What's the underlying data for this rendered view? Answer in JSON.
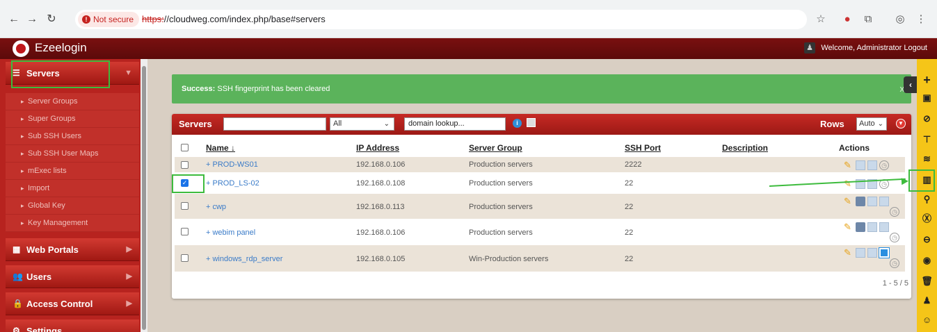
{
  "browser": {
    "not_secure": "Not secure",
    "url_scheme": "https:",
    "url_rest": "//cloudweg.com/index.php/base#servers"
  },
  "app": {
    "name": "Ezeelogin",
    "welcome": "Welcome, Administrator Logout"
  },
  "sidebar": {
    "servers": "Servers",
    "sub_items": [
      "Server Groups",
      "Super Groups",
      "Sub SSH Users",
      "Sub SSH User Maps",
      "mExec lists",
      "Import",
      "Global Key",
      "Key Management"
    ],
    "web_portals": "Web Portals",
    "users": "Users",
    "access_control": "Access Control",
    "settings": "Settings"
  },
  "banner": {
    "label": "Success:",
    "message": " SSH fingerprint has been cleared",
    "close": "x"
  },
  "panel": {
    "title": "Servers",
    "filter_selected": "All",
    "domain_lookup": "domain lookup...",
    "rows_label": "Rows",
    "rows_selected": "Auto",
    "headers": {
      "name": "Name ↓",
      "ip": "IP Address",
      "group": "Server Group",
      "port": "SSH Port",
      "desc": "Description",
      "actions": "Actions"
    },
    "rows": [
      {
        "name": "+ PROD-WS01",
        "ip": "192.168.0.106",
        "group": "Production servers",
        "port": "2222",
        "checked": false
      },
      {
        "name": "+ PROD_LS-02",
        "ip": "192.168.0.108",
        "group": "Production servers",
        "port": "22",
        "checked": true
      },
      {
        "name": "+ cwp",
        "ip": "192.168.0.113",
        "group": "Production servers",
        "port": "22",
        "checked": false
      },
      {
        "name": "+ webim panel",
        "ip": "192.168.0.106",
        "group": "Production servers",
        "port": "22",
        "checked": false
      },
      {
        "name": "+ windows_rdp_server",
        "ip": "192.168.0.105",
        "group": "Win-Production servers",
        "port": "22",
        "checked": false
      }
    ],
    "pager": "1 - 5 / 5"
  }
}
